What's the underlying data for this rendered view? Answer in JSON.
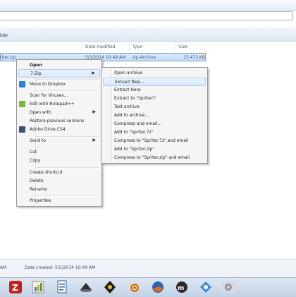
{
  "toolbar": {
    "label": "lder"
  },
  "columns": {
    "date_modified": "Date modified",
    "type": "Type",
    "size": "Size"
  },
  "file": {
    "name": "riter.zip",
    "date": "5/5/2014 10:49 AM",
    "type": "zip Archive",
    "size": "15,473 KB"
  },
  "context_menu": {
    "open": "Open",
    "sevenzip": "7-Zip",
    "dropbox": "Move to Dropbox",
    "scan": "Scan for Viruses...",
    "notepad": "Edit with Notepad++",
    "open_with": "Open with",
    "restore": "Restore previous versions",
    "adobe": "Adobe Drive CS4",
    "send_to": "Send to",
    "cut": "Cut",
    "copy": "Copy",
    "create_shortcut": "Create shortcut",
    "delete": "Delete",
    "rename": "Rename",
    "properties": "Properties"
  },
  "submenu_7zip": [
    "Open archive",
    "Extract files...",
    "Extract Here",
    "Extract to \"Spriter\\\"",
    "Test archive",
    "Add to archive...",
    "Compress and email...",
    "Add to \"Spriter.7z\"",
    "Compress to \"Spriter.7z\" and email",
    "Add to \"Spriter.zip\"",
    "Compress to \"Spriter.zip\" and email"
  ],
  "status": {
    "left": "AM",
    "date_created": "Date created: 5/5/2014 10:49 AM"
  },
  "taskbar_icons": [
    "filezilla-icon",
    "chart-app-icon",
    "document-app-icon",
    "inkscape-icon",
    "gps-app-icon",
    "blender-icon",
    "firefox-icon",
    "mu-app-icon",
    "network-app-icon",
    "settings-app-icon"
  ],
  "colors": {
    "highlight": "#d9e8fb",
    "menu_bg": "#f5f5f5",
    "selection": "#c3dcf8"
  }
}
